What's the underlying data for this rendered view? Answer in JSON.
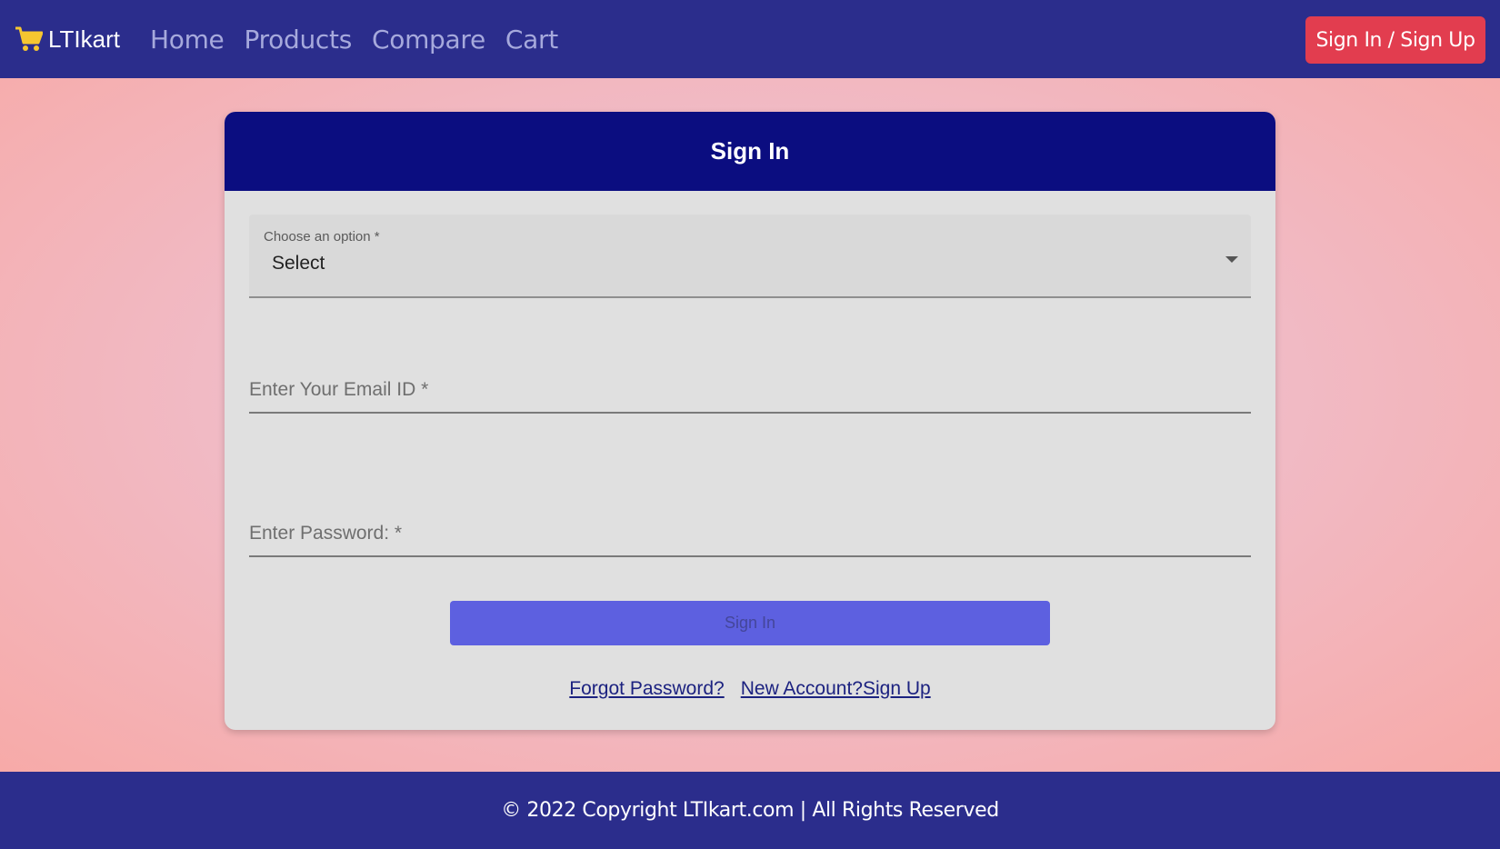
{
  "navbar": {
    "brand": "LTIkart",
    "brand_icon": "shopping-cart-icon",
    "links": [
      "Home",
      "Products",
      "Compare",
      "Cart"
    ],
    "auth_button": "Sign In / Sign Up"
  },
  "signin_card": {
    "title": "Sign In",
    "option_select": {
      "label": "Choose an option *",
      "value": "Select"
    },
    "email": {
      "placeholder": "Enter Your Email ID *",
      "value": ""
    },
    "password": {
      "placeholder": "Enter Password: *",
      "value": ""
    },
    "submit_label": "Sign In",
    "forgot_password": "Forgot Password?",
    "new_account": "New Account?Sign Up"
  },
  "footer": {
    "text": "© 2022 Copyright LTIkart.com | All Rights Reserved"
  },
  "colors": {
    "navbar_bg": "#2b2d8c",
    "auth_button_bg": "#e23d4f",
    "card_header_bg": "#0b0d80",
    "submit_bg": "#5d60e0"
  }
}
